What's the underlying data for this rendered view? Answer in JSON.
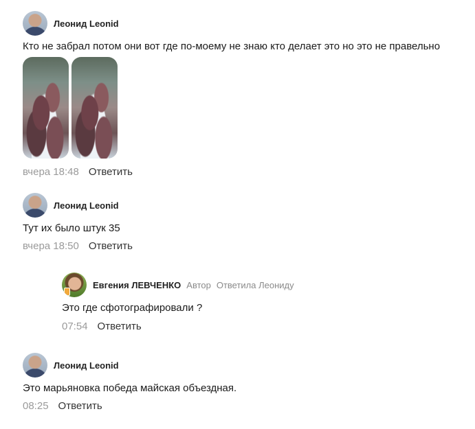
{
  "comments": [
    {
      "author": "Леонид Leonid",
      "text": "Кто не забрал потом они вот где по-моему не знаю кто делает это но это не правельно",
      "time": "вчера 18:48",
      "reply_label": "Ответить"
    },
    {
      "author": "Леонид Leonid",
      "text": "Тут их было штук 35",
      "time": "вчера 18:50",
      "reply_label": "Ответить"
    },
    {
      "author": "Евгения ЛЕВЧЕНКО",
      "author_tag": "Автор",
      "reply_to": "Ответила Леониду",
      "text": "Это где сфотографировали ?",
      "time": "07:54",
      "reply_label": "Ответить"
    },
    {
      "author": "Леонид Leonid",
      "text": "Это марьяновка победа майская объездная.",
      "time": "08:25",
      "reply_label": "Ответить"
    }
  ],
  "icons": {
    "avatar_leonid": "user-avatar",
    "avatar_evgenia": "user-avatar",
    "badge": "author-badge-icon"
  }
}
